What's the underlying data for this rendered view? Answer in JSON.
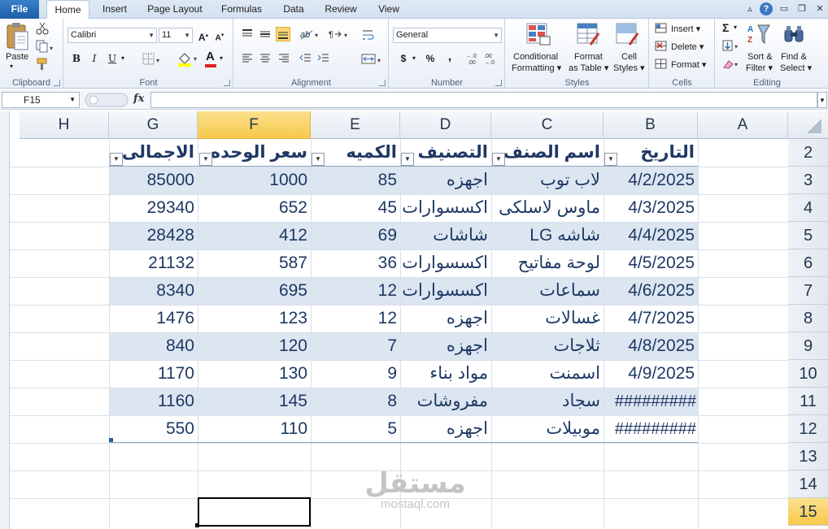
{
  "ribbon_tabs": [
    "File",
    "Home",
    "Insert",
    "Page Layout",
    "Formulas",
    "Data",
    "Review",
    "View"
  ],
  "clipboard": {
    "label": "Clipboard",
    "paste": "Paste"
  },
  "font": {
    "label": "Font",
    "name": "Calibri",
    "size": "11",
    "bold": "B",
    "italic": "I",
    "underline": "U",
    "grow": "A",
    "shrink": "A",
    "color_letter": "A"
  },
  "alignment": {
    "label": "Alignment"
  },
  "number": {
    "label": "Number",
    "format": "General",
    "currency": "$",
    "percent": "%",
    "comma": ","
  },
  "styles": {
    "label": "Styles",
    "conditional_1": "Conditional",
    "conditional_2": "Formatting",
    "format_table_1": "Format",
    "format_table_2": "as Table",
    "cell_styles_1": "Cell",
    "cell_styles_2": "Styles"
  },
  "cells": {
    "label": "Cells",
    "insert": "Insert",
    "delete": "Delete",
    "format": "Format"
  },
  "editing": {
    "label": "Editing",
    "sigma": "Σ",
    "sort_1": "Sort &",
    "sort_2": "Filter",
    "find_1": "Find &",
    "find_2": "Select"
  },
  "formula_bar": {
    "name_box": "F15",
    "fx": "fx",
    "value": ""
  },
  "columns": [
    "H",
    "G",
    "F",
    "E",
    "D",
    "C",
    "B",
    "A"
  ],
  "rows": [
    "2",
    "3",
    "4",
    "5",
    "6",
    "7",
    "8",
    "9",
    "10",
    "11",
    "12",
    "13",
    "14",
    "15"
  ],
  "table": {
    "headers": {
      "G": "الاجمالى",
      "F": "سعر الوحده",
      "E": "الكميه",
      "D": "التصنيف",
      "C": "اسم الصنف",
      "B": "التاريخ"
    },
    "rows": [
      {
        "B": "4/2/2025",
        "C": "لاب توب",
        "D": "اجهزه",
        "E": "85",
        "F": "1000",
        "G": "85000"
      },
      {
        "B": "4/3/2025",
        "C": "ماوس لاسلكى",
        "D": "اكسسوارات",
        "E": "45",
        "F": "652",
        "G": "29340"
      },
      {
        "B": "4/4/2025",
        "C": "شاشه LG",
        "D": "شاشات",
        "E": "69",
        "F": "412",
        "G": "28428"
      },
      {
        "B": "4/5/2025",
        "C": "لوحة مفاتيح",
        "D": "اكسسوارات",
        "E": "36",
        "F": "587",
        "G": "21132"
      },
      {
        "B": "4/6/2025",
        "C": "سماعات",
        "D": "اكسسوارات",
        "E": "12",
        "F": "695",
        "G": "8340"
      },
      {
        "B": "4/7/2025",
        "C": "غسالات",
        "D": "اجهزه",
        "E": "12",
        "F": "123",
        "G": "1476"
      },
      {
        "B": "4/8/2025",
        "C": "ثلاجات",
        "D": "اجهزه",
        "E": "7",
        "F": "120",
        "G": "840"
      },
      {
        "B": "4/9/2025",
        "C": "اسمنت",
        "D": "مواد بناء",
        "E": "9",
        "F": "130",
        "G": "1170"
      },
      {
        "B": "#########",
        "C": "سجاد",
        "D": "مفروشات",
        "E": "8",
        "F": "145",
        "G": "1160"
      },
      {
        "B": "#########",
        "C": "موبيلات",
        "D": "اجهزه",
        "E": "5",
        "F": "110",
        "G": "550"
      }
    ]
  },
  "watermark": {
    "arabic": "مستقل",
    "latin": "mostaql.com"
  },
  "colors": {
    "band": "#dce6f1",
    "text": "#1f3864",
    "selection": "#f7c84a"
  }
}
